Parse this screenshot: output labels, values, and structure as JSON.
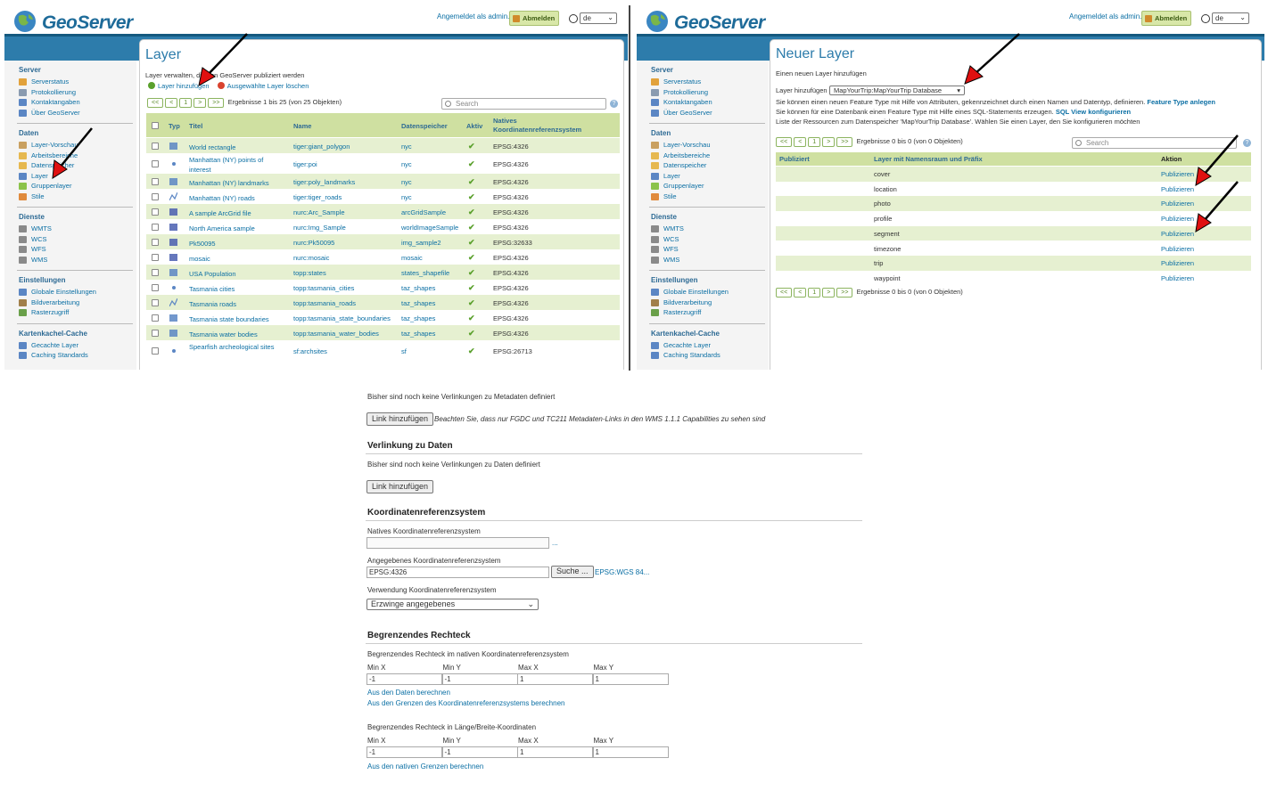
{
  "left": {
    "header": {
      "brand": "GeoServer",
      "logged_in": "Angemeldet als admin.",
      "logout": "Abmelden",
      "lang": "de"
    },
    "nav": {
      "sections": [
        {
          "title": "Server",
          "items": [
            "Serverstatus",
            "Protokollierung",
            "Kontaktangaben",
            "Über GeoServer"
          ]
        },
        {
          "title": "Daten",
          "items": [
            "Layer-Vorschau",
            "Arbeitsbereiche",
            "Datenspeicher",
            "Layer",
            "Gruppenlayer",
            "Stile"
          ]
        },
        {
          "title": "Dienste",
          "items": [
            "WMTS",
            "WCS",
            "WFS",
            "WMS"
          ]
        },
        {
          "title": "Einstellungen",
          "items": [
            "Globale Einstellungen",
            "Bildverarbeitung",
            "Rasterzugriff"
          ]
        },
        {
          "title": "Kartenkachel-Cache",
          "items": [
            "Gecachte Layer",
            "Caching Standards"
          ]
        }
      ]
    },
    "page": {
      "title": "Layer",
      "subtitle": "Layer verwalten, die von GeoServer publiziert werden",
      "add_layer": "Layer hinzufügen",
      "delete_selected": "Ausgewählte Layer löschen",
      "pager": {
        "first": "<<",
        "prev": "<",
        "page": "1",
        "next": ">",
        "last": ">>",
        "results": "Ergebnisse 1 bis 25 (von 25 Objekten)"
      },
      "search_placeholder": "Search",
      "columns": [
        "Typ",
        "Titel",
        "Name",
        "Datenspeicher",
        "Aktiv",
        "Natives Koordinatenreferenzsystem"
      ],
      "rows": [
        {
          "type": "polygon",
          "title": "World rectangle",
          "name": "tiger:giant_polygon",
          "store": "nyc",
          "srs": "EPSG:4326"
        },
        {
          "type": "point",
          "title": "Manhattan (NY) points of interest",
          "name": "tiger:poi",
          "store": "nyc",
          "srs": "EPSG:4326"
        },
        {
          "type": "polygon",
          "title": "Manhattan (NY) landmarks",
          "name": "tiger:poly_landmarks",
          "store": "nyc",
          "srs": "EPSG:4326"
        },
        {
          "type": "line",
          "title": "Manhattan (NY) roads",
          "name": "tiger:tiger_roads",
          "store": "nyc",
          "srs": "EPSG:4326"
        },
        {
          "type": "raster",
          "title": "A sample ArcGrid file",
          "name": "nurc:Arc_Sample",
          "store": "arcGridSample",
          "srs": "EPSG:4326"
        },
        {
          "type": "raster",
          "title": "North America sample imagery",
          "name": "nurc:Img_Sample",
          "store": "worldImageSample",
          "srs": "EPSG:4326"
        },
        {
          "type": "raster",
          "title": "Pk50095",
          "name": "nurc:Pk50095",
          "store": "img_sample2",
          "srs": "EPSG:32633"
        },
        {
          "type": "raster",
          "title": "mosaic",
          "name": "nurc:mosaic",
          "store": "mosaic",
          "srs": "EPSG:4326"
        },
        {
          "type": "polygon",
          "title": "USA Population",
          "name": "topp:states",
          "store": "states_shapefile",
          "srs": "EPSG:4326"
        },
        {
          "type": "point",
          "title": "Tasmania cities",
          "name": "topp:tasmania_cities",
          "store": "taz_shapes",
          "srs": "EPSG:4326"
        },
        {
          "type": "line",
          "title": "Tasmania roads",
          "name": "topp:tasmania_roads",
          "store": "taz_shapes",
          "srs": "EPSG:4326"
        },
        {
          "type": "polygon",
          "title": "Tasmania state boundaries",
          "name": "topp:tasmania_state_boundaries",
          "store": "taz_shapes",
          "srs": "EPSG:4326"
        },
        {
          "type": "polygon",
          "title": "Tasmania water bodies",
          "name": "topp:tasmania_water_bodies",
          "store": "taz_shapes",
          "srs": "EPSG:4326"
        },
        {
          "type": "point",
          "title": "Spearfish archeological sites",
          "name": "sf:archsites",
          "store": "sf",
          "srs": "EPSG:26713"
        }
      ]
    }
  },
  "right": {
    "header": {
      "brand": "GeoServer",
      "logged_in": "Angemeldet als admin.",
      "logout": "Abmelden",
      "lang": "de"
    },
    "page": {
      "title": "Neuer Layer",
      "subtitle": "Einen neuen Layer hinzufügen",
      "add_from_label": "Layer hinzufügen",
      "add_from_value": "MapYourTrip:MapYourTrip Database",
      "info1": "Sie können einen neuen Feature Type mit Hilfe von Attributen, gekennzeichnet durch einen Namen und Datentyp, definieren.",
      "info1_link": "Feature Type anlegen",
      "info2": "Sie können für eine Datenbank einen Feature Type mit Hilfe eines SQL-Statements erzeugen.",
      "info2_link": "SQL View konfigurieren",
      "info3": "Liste der Ressourcen zum Datenspeicher 'MapYourTrip Database'. Wählen Sie einen Layer, den Sie konfigurieren möchten",
      "pager": {
        "first": "<<",
        "prev": "<",
        "page": "1",
        "next": ">",
        "last": ">>",
        "results": "Ergebnisse 0 bis 0 (von 0 Objekten)"
      },
      "search_placeholder": "Search",
      "columns": [
        "Publiziert",
        "Layer mit Namensraum und Präfix",
        "Aktion"
      ],
      "rows": [
        "cover",
        "location",
        "photo",
        "profile",
        "segment",
        "timezone",
        "trip",
        "waypoint"
      ],
      "action": "Publizieren"
    }
  },
  "lower": {
    "meta_none": "Bisher sind noch keine Verlinkungen zu Metadaten definiert",
    "add_link": "Link hinzufügen",
    "meta_note": "Beachten Sie, dass nur FGDC und TC211 Metadaten-Links in den WMS 1.1.1 Capabilities zu sehen sind",
    "data_links_title": "Verlinkung zu Daten",
    "data_none": "Bisher sind noch keine Verlinkungen zu Daten definiert",
    "crs_title": "Koordinatenreferenzsystem",
    "native_crs_label": "Natives Koordinatenreferenzsystem",
    "native_crs_value": "",
    "ellipsis": "...",
    "declared_crs_label": "Angegebenes Koordinatenreferenzsystem",
    "declared_crs_value": "EPSG:4326",
    "find_button": "Suche ...",
    "declared_crs_link": "EPSG:WGS 84...",
    "srs_handling_label": "Verwendung Koordinatenreferenzsystem",
    "srs_handling_value": "Erzwinge angegebenes",
    "bbox_title": "Begrenzendes Rechteck",
    "native_bbox_label": "Begrenzendes Rechteck im nativen Koordinatenreferenzsystem",
    "bbox_cols": [
      "Min X",
      "Min Y",
      "Max X",
      "Max Y"
    ],
    "native_bbox": [
      "-1",
      "-1",
      "1",
      "1"
    ],
    "compute_from_data": "Aus den Daten berechnen",
    "compute_from_srs": "Aus den Grenzen des Koordinatenreferenzsystems berechnen",
    "latlon_bbox_label": "Begrenzendes Rechteck in Länge/Breite-Koordinaten",
    "latlon_bbox": [
      "-1",
      "-1",
      "1",
      "1"
    ],
    "compute_from_native": "Aus den nativen Grenzen berechnen"
  }
}
